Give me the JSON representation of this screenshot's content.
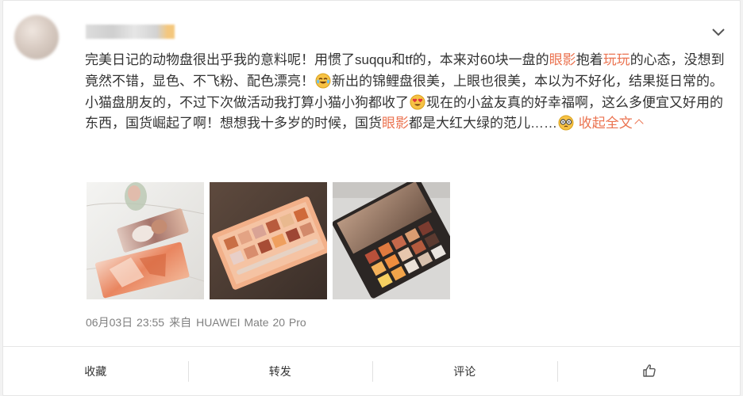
{
  "post": {
    "text_parts": {
      "p1": "完美日记的动物盘很出乎我的意料呢！用惯了suqqu和tf的，本来对60块一盘的",
      "kw1": "眼影",
      "p2": "抱着",
      "kw2": "玩玩",
      "p3": "的心态，没想到竟然不错，显色、不飞粉、配色漂亮！",
      "p4": "新出的锦鲤盘很美，上眼也很美，本以为不好化，结果挺日常的。小猫盘朋友的，不过下次做活动我打算小猫小狗都收了",
      "p5": "现在的小盆友真的好幸福啊，这么多便宜又好用的东西，国货崛起了啊！想想我十多岁的时候，国货",
      "kw3": "眼影",
      "p6": "都是大红大绿的范儿……"
    },
    "collapse_label": "收起全文",
    "timestamp": "06月03日 23:55",
    "source_prefix": "来自",
    "device": "HUAWEI Mate 20 Pro",
    "photos": [
      {
        "desc": "eyeshadow palettes on marble"
      },
      {
        "desc": "orange eyeshadow palette"
      },
      {
        "desc": "open eyeshadow palette"
      }
    ]
  },
  "actions": {
    "favorite": "收藏",
    "repost": "转发",
    "comment": "评论"
  },
  "colors": {
    "keyword": "#eb7350",
    "meta": "#808080"
  },
  "icons": {
    "more": "chevron-down-icon",
    "like": "thumbs-up-icon"
  }
}
